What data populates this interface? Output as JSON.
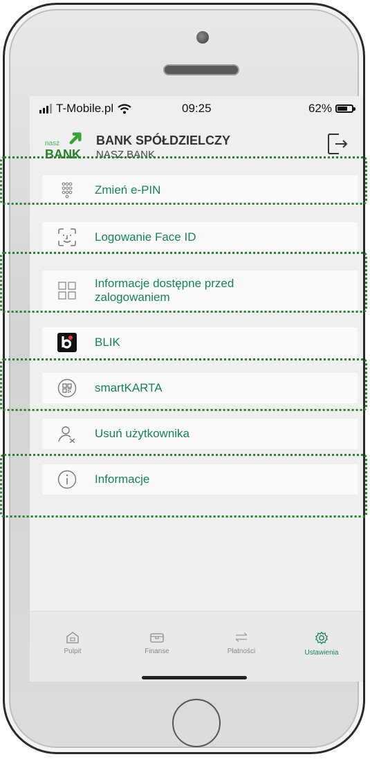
{
  "status_bar": {
    "carrier": "T-Mobile.pl",
    "time": "09:25",
    "battery": "62%"
  },
  "header": {
    "logo_small": "nasz",
    "logo_bank": "BANK",
    "bank_name": "BANK SPÓŁDZIELCZY",
    "bank_subname": "NASZ BANK"
  },
  "menu": {
    "items": [
      {
        "label": "Zmień e-PIN",
        "icon": "keypad-icon"
      },
      {
        "label": "Logowanie Face ID",
        "icon": "face-id-icon"
      },
      {
        "label": "Informacje dostępne przed\nzalogowaniem",
        "icon": "grid-icon"
      },
      {
        "label": "BLIK",
        "icon": "blik-icon"
      },
      {
        "label": "smartKARTA",
        "icon": "qr-card-icon"
      },
      {
        "label": "Usuń użytkownika",
        "icon": "user-remove-icon"
      },
      {
        "label": "Informacje",
        "icon": "info-icon"
      }
    ]
  },
  "tabs": [
    {
      "label": "Pulpit",
      "icon": "home-icon"
    },
    {
      "label": "Finanse",
      "icon": "wallet-icon"
    },
    {
      "label": "Płatności",
      "icon": "transfer-icon"
    },
    {
      "label": "Ustawienia",
      "icon": "gear-icon",
      "active": true
    }
  ],
  "colors": {
    "accent": "#1a7f5a",
    "highlight": "#2e7d32",
    "tab_inactive": "#888888"
  }
}
